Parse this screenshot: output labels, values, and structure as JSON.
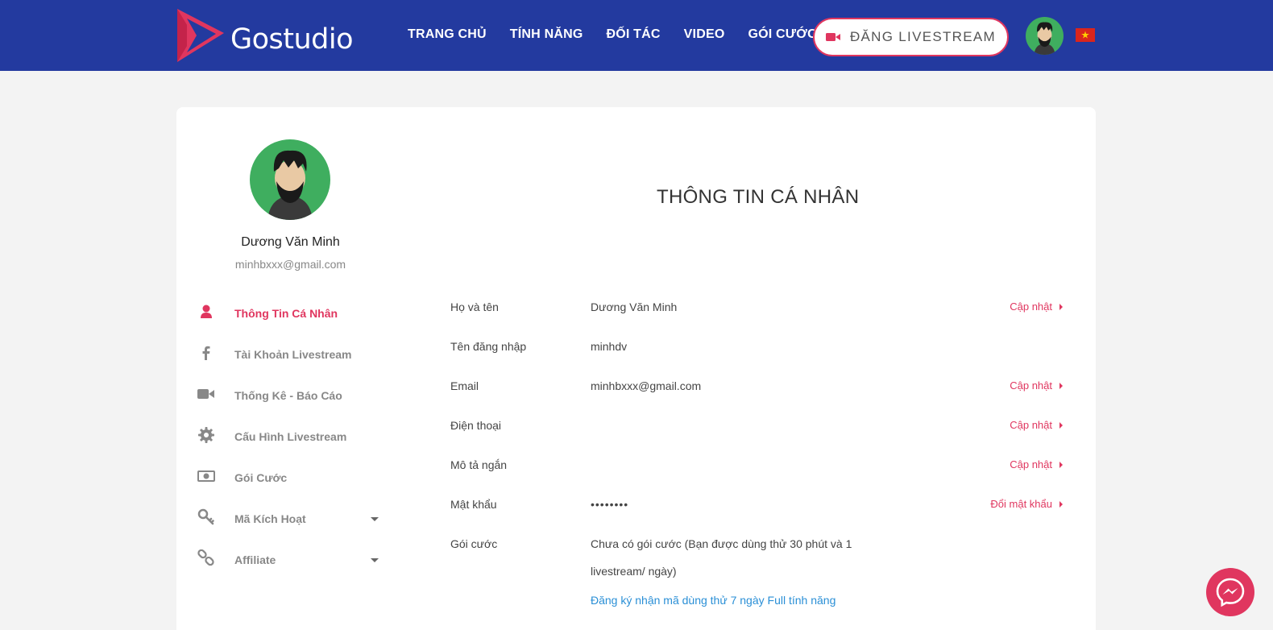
{
  "brand": {
    "name": "Gostudio",
    "accent": "#e0365f",
    "header_bg": "#233a9f"
  },
  "nav": [
    {
      "label": "TRANG CHỦ"
    },
    {
      "label": "TÍNH NĂNG"
    },
    {
      "label": "ĐỐI TÁC"
    },
    {
      "label": "VIDEO"
    },
    {
      "label": "GÓI CƯỚC"
    }
  ],
  "header": {
    "livestream_button": "ĐĂNG LIVESTREAM",
    "language_flag": "vietnam-flag-icon"
  },
  "profile": {
    "name": "Dương Văn Minh",
    "email": "minhbxxx@gmail.com"
  },
  "menu": [
    {
      "label": "Thông Tin Cá Nhân",
      "icon": "user-icon",
      "active": true
    },
    {
      "label": "Tài Khoản Livestream",
      "icon": "facebook-icon"
    },
    {
      "label": "Thống Kê - Báo Cáo",
      "icon": "video-camera-icon"
    },
    {
      "label": "Cấu Hình Livestream",
      "icon": "gear-icon"
    },
    {
      "label": "Gói Cước",
      "icon": "money-icon"
    },
    {
      "label": "Mã Kích Hoạt",
      "icon": "key-icon",
      "expandable": true
    },
    {
      "label": "Affiliate",
      "icon": "link-icon",
      "expandable": true
    }
  ],
  "section_title": "THÔNG TIN CÁ NHÂN",
  "fields": {
    "full_name": {
      "label": "Họ và tên",
      "value": "Dương Văn Minh",
      "action": "Cập nhật"
    },
    "username": {
      "label": "Tên đăng nhập",
      "value": "minhdv"
    },
    "email": {
      "label": "Email",
      "value": "minhbxxx@gmail.com",
      "action": "Cập nhật"
    },
    "phone": {
      "label": "Điện thoại",
      "value": "",
      "action": "Cập nhật"
    },
    "bio": {
      "label": "Mô tả ngắn",
      "value": "",
      "action": "Cập nhật"
    },
    "password": {
      "label": "Mật khẩu",
      "value": "••••••••",
      "action": "Đổi mật khẩu"
    },
    "plan": {
      "label": "Gói cước",
      "value": "Chưa có gói cước (Bạn được dùng thử 30 phút và 1 livestream/ ngày)",
      "link": "Đăng ký nhận mã dùng thử 7 ngày Full tính năng"
    }
  }
}
